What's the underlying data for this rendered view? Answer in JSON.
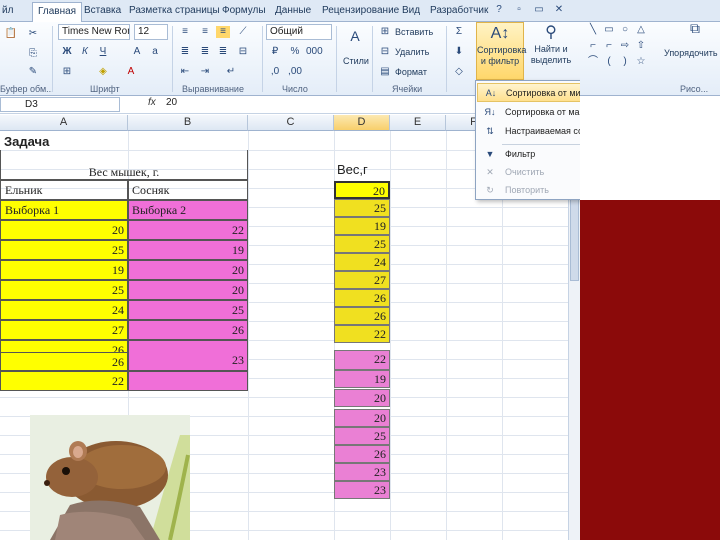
{
  "tabs": [
    "йл",
    "Главная",
    "Вставка",
    "Разметка страницы",
    "Формулы",
    "Данные",
    "Рецензирование",
    "Вид",
    "Разработчик"
  ],
  "ribbon": {
    "clipboard_label": "Буфер обм...",
    "font_name": "Times New Rom",
    "font_size": "12",
    "font_label": "Шрифт",
    "align_label": "Выравнивание",
    "number_format": "Общий",
    "number_label": "Число",
    "styles_label": "Стили",
    "insert_label": "Вставить",
    "delete_label": "Удалить",
    "format_label": "Формат",
    "cells_label": "Ячейки",
    "sort_filter_line1": "Сортировка",
    "sort_filter_line2": "и фильтр",
    "find_line1": "Найти и",
    "find_line2": "выделить",
    "arrange_label": "Упорядочить",
    "draw_label": "Рисо..."
  },
  "formula_bar": {
    "name_box": "D3",
    "fx": "fx",
    "value": "20"
  },
  "columns": [
    "A",
    "B",
    "C",
    "D",
    "E",
    "F"
  ],
  "sheet": {
    "title": "Задача",
    "table_header": "Вес мышек, г.",
    "col_a_header": "Ельник",
    "col_b_header": "Сосняк",
    "col_a_sample": "Выборка 1",
    "col_b_sample": "Выборка 2",
    "col_a_values": [
      "20",
      "25",
      "19",
      "25",
      "24",
      "27",
      "26",
      "26",
      "26",
      "22"
    ],
    "col_b_values": [
      "22",
      "19",
      "20",
      "20",
      "25",
      "26",
      "23",
      "",
      "23",
      ""
    ],
    "d_header": "Вес,г",
    "d_values": [
      "20",
      "25",
      "19",
      "25",
      "24",
      "27",
      "26",
      "26",
      "22",
      "22",
      "19",
      "20",
      "20",
      "25",
      "26",
      "23",
      "23"
    ]
  },
  "dropdown": {
    "items": [
      {
        "label": "Сортировка от минимального к максимальному",
        "icon": "sort-asc-icon",
        "glyph": "A↓"
      },
      {
        "label": "Сортировка от максимального к минимальному",
        "icon": "sort-desc-icon",
        "glyph": "Я↓"
      },
      {
        "label": "Настраиваемая сортировка...",
        "icon": "custom-sort-icon",
        "glyph": "⇅"
      },
      {
        "label": "Фильтр",
        "icon": "filter-icon",
        "glyph": "▼"
      },
      {
        "label": "Очистить",
        "icon": "clear-filter-icon",
        "glyph": "✕"
      },
      {
        "label": "Повторить",
        "icon": "reapply-icon",
        "glyph": "↻"
      }
    ]
  },
  "colors": {
    "yellow": "#ffff00",
    "pink": "#f06fd8",
    "accent": "#ffd76b",
    "frame": "#8b0a0a"
  }
}
